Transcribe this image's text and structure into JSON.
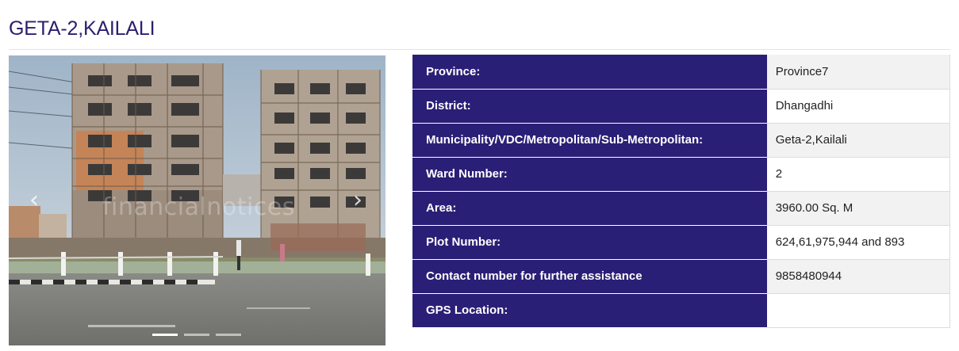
{
  "page": {
    "title": "GETA-2,KAILALI"
  },
  "carousel": {
    "prev_icon": "chevron-left-icon",
    "next_icon": "chevron-right-icon",
    "prev_glyph": "‹",
    "next_glyph": "›",
    "watermark": "financialnotices",
    "slide_count": 3,
    "active_slide": 1
  },
  "details": {
    "rows": [
      {
        "label": "Province:",
        "value": "Province7"
      },
      {
        "label": "District:",
        "value": "Dhangadhi"
      },
      {
        "label": "Municipality/VDC/Metropolitan/Sub-Metropolitan:",
        "value": "Geta-2,Kailali"
      },
      {
        "label": "Ward Number:",
        "value": "2"
      },
      {
        "label": "Area:",
        "value": "3960.00 Sq. M"
      },
      {
        "label": "Plot Number:",
        "value": "624,61,975,944 and 893"
      },
      {
        "label": "Contact number for further assistance",
        "value": "9858480944"
      },
      {
        "label": "GPS Location:",
        "value": ""
      }
    ]
  },
  "colors": {
    "accent": "#2a1f76",
    "title": "#2a1f6f"
  }
}
